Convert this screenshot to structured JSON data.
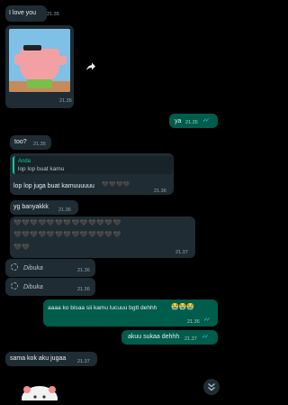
{
  "messages": {
    "m1": {
      "text": "I love you",
      "time": "21.35"
    },
    "m2": {
      "time": "21.35"
    },
    "m3": {
      "text": "ya",
      "time": "21.35"
    },
    "m4": {
      "text": "too?",
      "time": "21.35"
    },
    "m5": {
      "quote_author": "Anda",
      "quote_text": "lop lop buat kamu",
      "text": "lop lop juga buat kamuuuuuu",
      "hearts": "🖤🖤🖤🖤",
      "time": "21.36"
    },
    "m6": {
      "text": "yg banyakkk",
      "time": "21.36"
    },
    "m7": {
      "line1": "🖤🖤🖤🖤🖤🖤🖤🖤🖤🖤🖤🖤🖤",
      "line2": "🖤🖤🖤🖤🖤🖤🖤🖤🖤🖤🖤🖤🖤",
      "line3": "🖤🖤",
      "time": "21.37"
    },
    "m8": {
      "text": "Dibuka",
      "time": "21.36"
    },
    "m9": {
      "text": "Dibuka",
      "time": "21.36"
    },
    "m10": {
      "text": "aaaa ko bisaa sii kamu lucuuu bgtt dehhh",
      "emoji": "😭😭😭",
      "time": "21.36"
    },
    "m11": {
      "text": "akuu sukaa dehhh",
      "time": "21.37"
    },
    "m12": {
      "text": "sama kok aku jugaa",
      "time": "21.37"
    }
  },
  "icons": {
    "forward": "forward-arrow-icon",
    "scroll": "double-chevron-down-icon",
    "view_once": "view-once-icon"
  }
}
